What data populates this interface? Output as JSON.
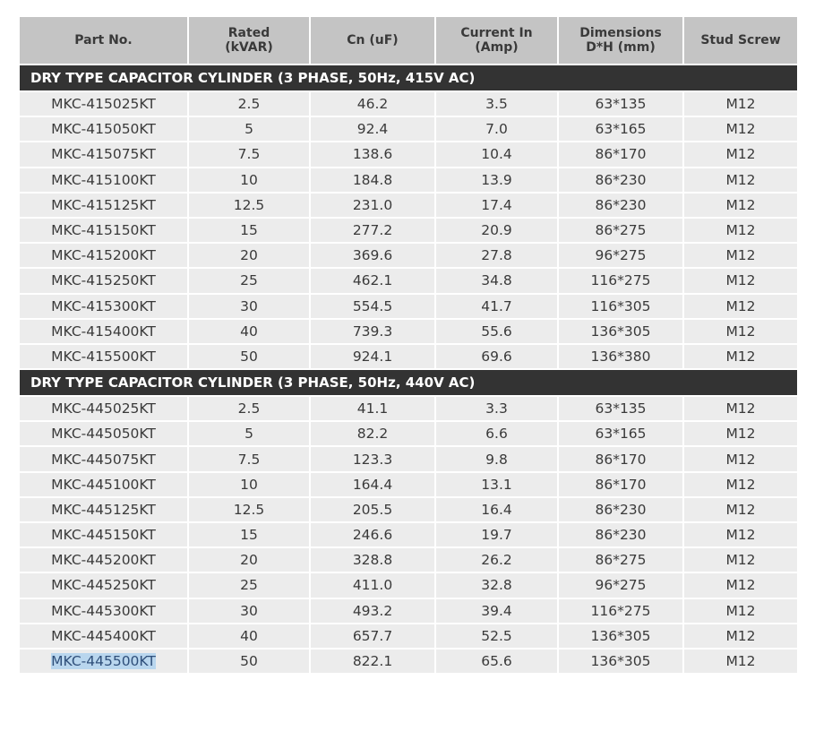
{
  "headers": [
    {
      "lines": [
        "Part No."
      ]
    },
    {
      "lines": [
        "Rated",
        "(kVAR)"
      ]
    },
    {
      "lines": [
        "Cn (uF)"
      ]
    },
    {
      "lines": [
        "Current In",
        "(Amp)"
      ]
    },
    {
      "lines": [
        "Dimensions",
        "D*H (mm)"
      ]
    },
    {
      "lines": [
        "Stud Screw"
      ]
    }
  ],
  "sections": [
    {
      "title": "DRY TYPE CAPACITOR CYLINDER (3 PHASE, 50Hz, 415V AC)",
      "rows": [
        [
          "MKC-415025KT",
          "2.5",
          "46.2",
          "3.5",
          "63*135",
          "M12"
        ],
        [
          "MKC-415050KT",
          "5",
          "92.4",
          "7.0",
          "63*165",
          "M12"
        ],
        [
          "MKC-415075KT",
          "7.5",
          "138.6",
          "10.4",
          "86*170",
          "M12"
        ],
        [
          "MKC-415100KT",
          "10",
          "184.8",
          "13.9",
          "86*230",
          "M12"
        ],
        [
          "MKC-415125KT",
          "12.5",
          "231.0",
          "17.4",
          "86*230",
          "M12"
        ],
        [
          "MKC-415150KT",
          "15",
          "277.2",
          "20.9",
          "86*275",
          "M12"
        ],
        [
          "MKC-415200KT",
          "20",
          "369.6",
          "27.8",
          "96*275",
          "M12"
        ],
        [
          "MKC-415250KT",
          "25",
          "462.1",
          "34.8",
          "116*275",
          "M12"
        ],
        [
          "MKC-415300KT",
          "30",
          "554.5",
          "41.7",
          "116*305",
          "M12"
        ],
        [
          "MKC-415400KT",
          "40",
          "739.3",
          "55.6",
          "136*305",
          "M12"
        ],
        [
          "MKC-415500KT",
          "50",
          "924.1",
          "69.6",
          "136*380",
          "M12"
        ]
      ]
    },
    {
      "title": "DRY TYPE CAPACITOR CYLINDER (3 PHASE, 50Hz, 440V AC)",
      "rows": [
        [
          "MKC-445025KT",
          "2.5",
          "41.1",
          "3.3",
          "63*135",
          "M12"
        ],
        [
          "MKC-445050KT",
          "5",
          "82.2",
          "6.6",
          "63*165",
          "M12"
        ],
        [
          "MKC-445075KT",
          "7.5",
          "123.3",
          "9.8",
          "86*170",
          "M12"
        ],
        [
          "MKC-445100KT",
          "10",
          "164.4",
          "13.1",
          "86*170",
          "M12"
        ],
        [
          "MKC-445125KT",
          "12.5",
          "205.5",
          "16.4",
          "86*230",
          "M12"
        ],
        [
          "MKC-445150KT",
          "15",
          "246.6",
          "19.7",
          "86*230",
          "M12"
        ],
        [
          "MKC-445200KT",
          "20",
          "328.8",
          "26.2",
          "86*275",
          "M12"
        ],
        [
          "MKC-445250KT",
          "25",
          "411.0",
          "32.8",
          "96*275",
          "M12"
        ],
        [
          "MKC-445300KT",
          "30",
          "493.2",
          "39.4",
          "116*275",
          "M12"
        ],
        [
          "MKC-445400KT",
          "40",
          "657.7",
          "52.5",
          "136*305",
          "M12"
        ],
        [
          "MKC-445500KT",
          "50",
          "822.1",
          "65.6",
          "136*305",
          "M12"
        ]
      ]
    }
  ],
  "selection": {
    "section": 1,
    "row": 10,
    "col": 0
  },
  "colors": {
    "header_bg": "#c4c4c4",
    "section_bg": "#333333",
    "row_bg": "#ececec",
    "selection_bg": "#b9d6ee"
  }
}
